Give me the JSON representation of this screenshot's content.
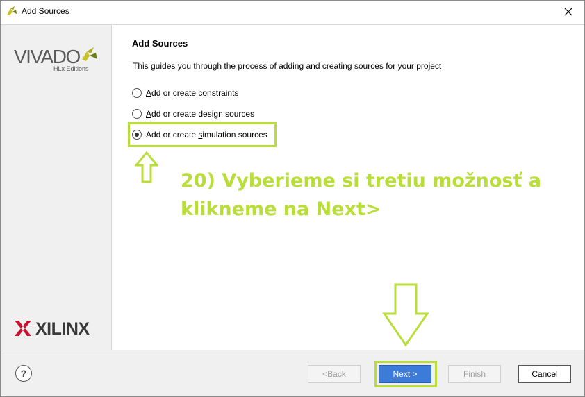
{
  "window": {
    "title": "Add Sources"
  },
  "sidebar": {
    "vivado_word": "VIVADO",
    "vivado_sub": "HLx Editions",
    "xilinx_word": "XILINX"
  },
  "main": {
    "heading": "Add Sources",
    "description": "This guides you through the process of adding and creating sources for your project",
    "options": [
      {
        "label_pre": "",
        "label_ul": "A",
        "label_post": "dd or create constraints",
        "checked": false
      },
      {
        "label_pre": "",
        "label_ul": "A",
        "label_post": "dd or create design sources",
        "checked": false
      },
      {
        "label_pre": "Add or create ",
        "label_ul": "s",
        "label_post": "imulation sources",
        "checked": true
      }
    ],
    "annotation": {
      "line1": "20) Vyberieme si tretiu možnosť a",
      "line2": "klikneme na Next>"
    }
  },
  "footer": {
    "help_label": "?",
    "back_label_pre": "< ",
    "back_label_ul": "B",
    "back_label_post": "ack",
    "next_label_ul": "N",
    "next_label_post": "ext >",
    "finish_label_ul": "F",
    "finish_label_post": "inish",
    "cancel_label": "Cancel"
  },
  "colors": {
    "annotation_green": "#b9de3a",
    "primary_blue": "#3d7bd9",
    "sidebar_bg": "#f0f0f0"
  },
  "icons": {
    "title": "vivado-app-icon",
    "close": "close-icon",
    "help": "help-icon"
  }
}
